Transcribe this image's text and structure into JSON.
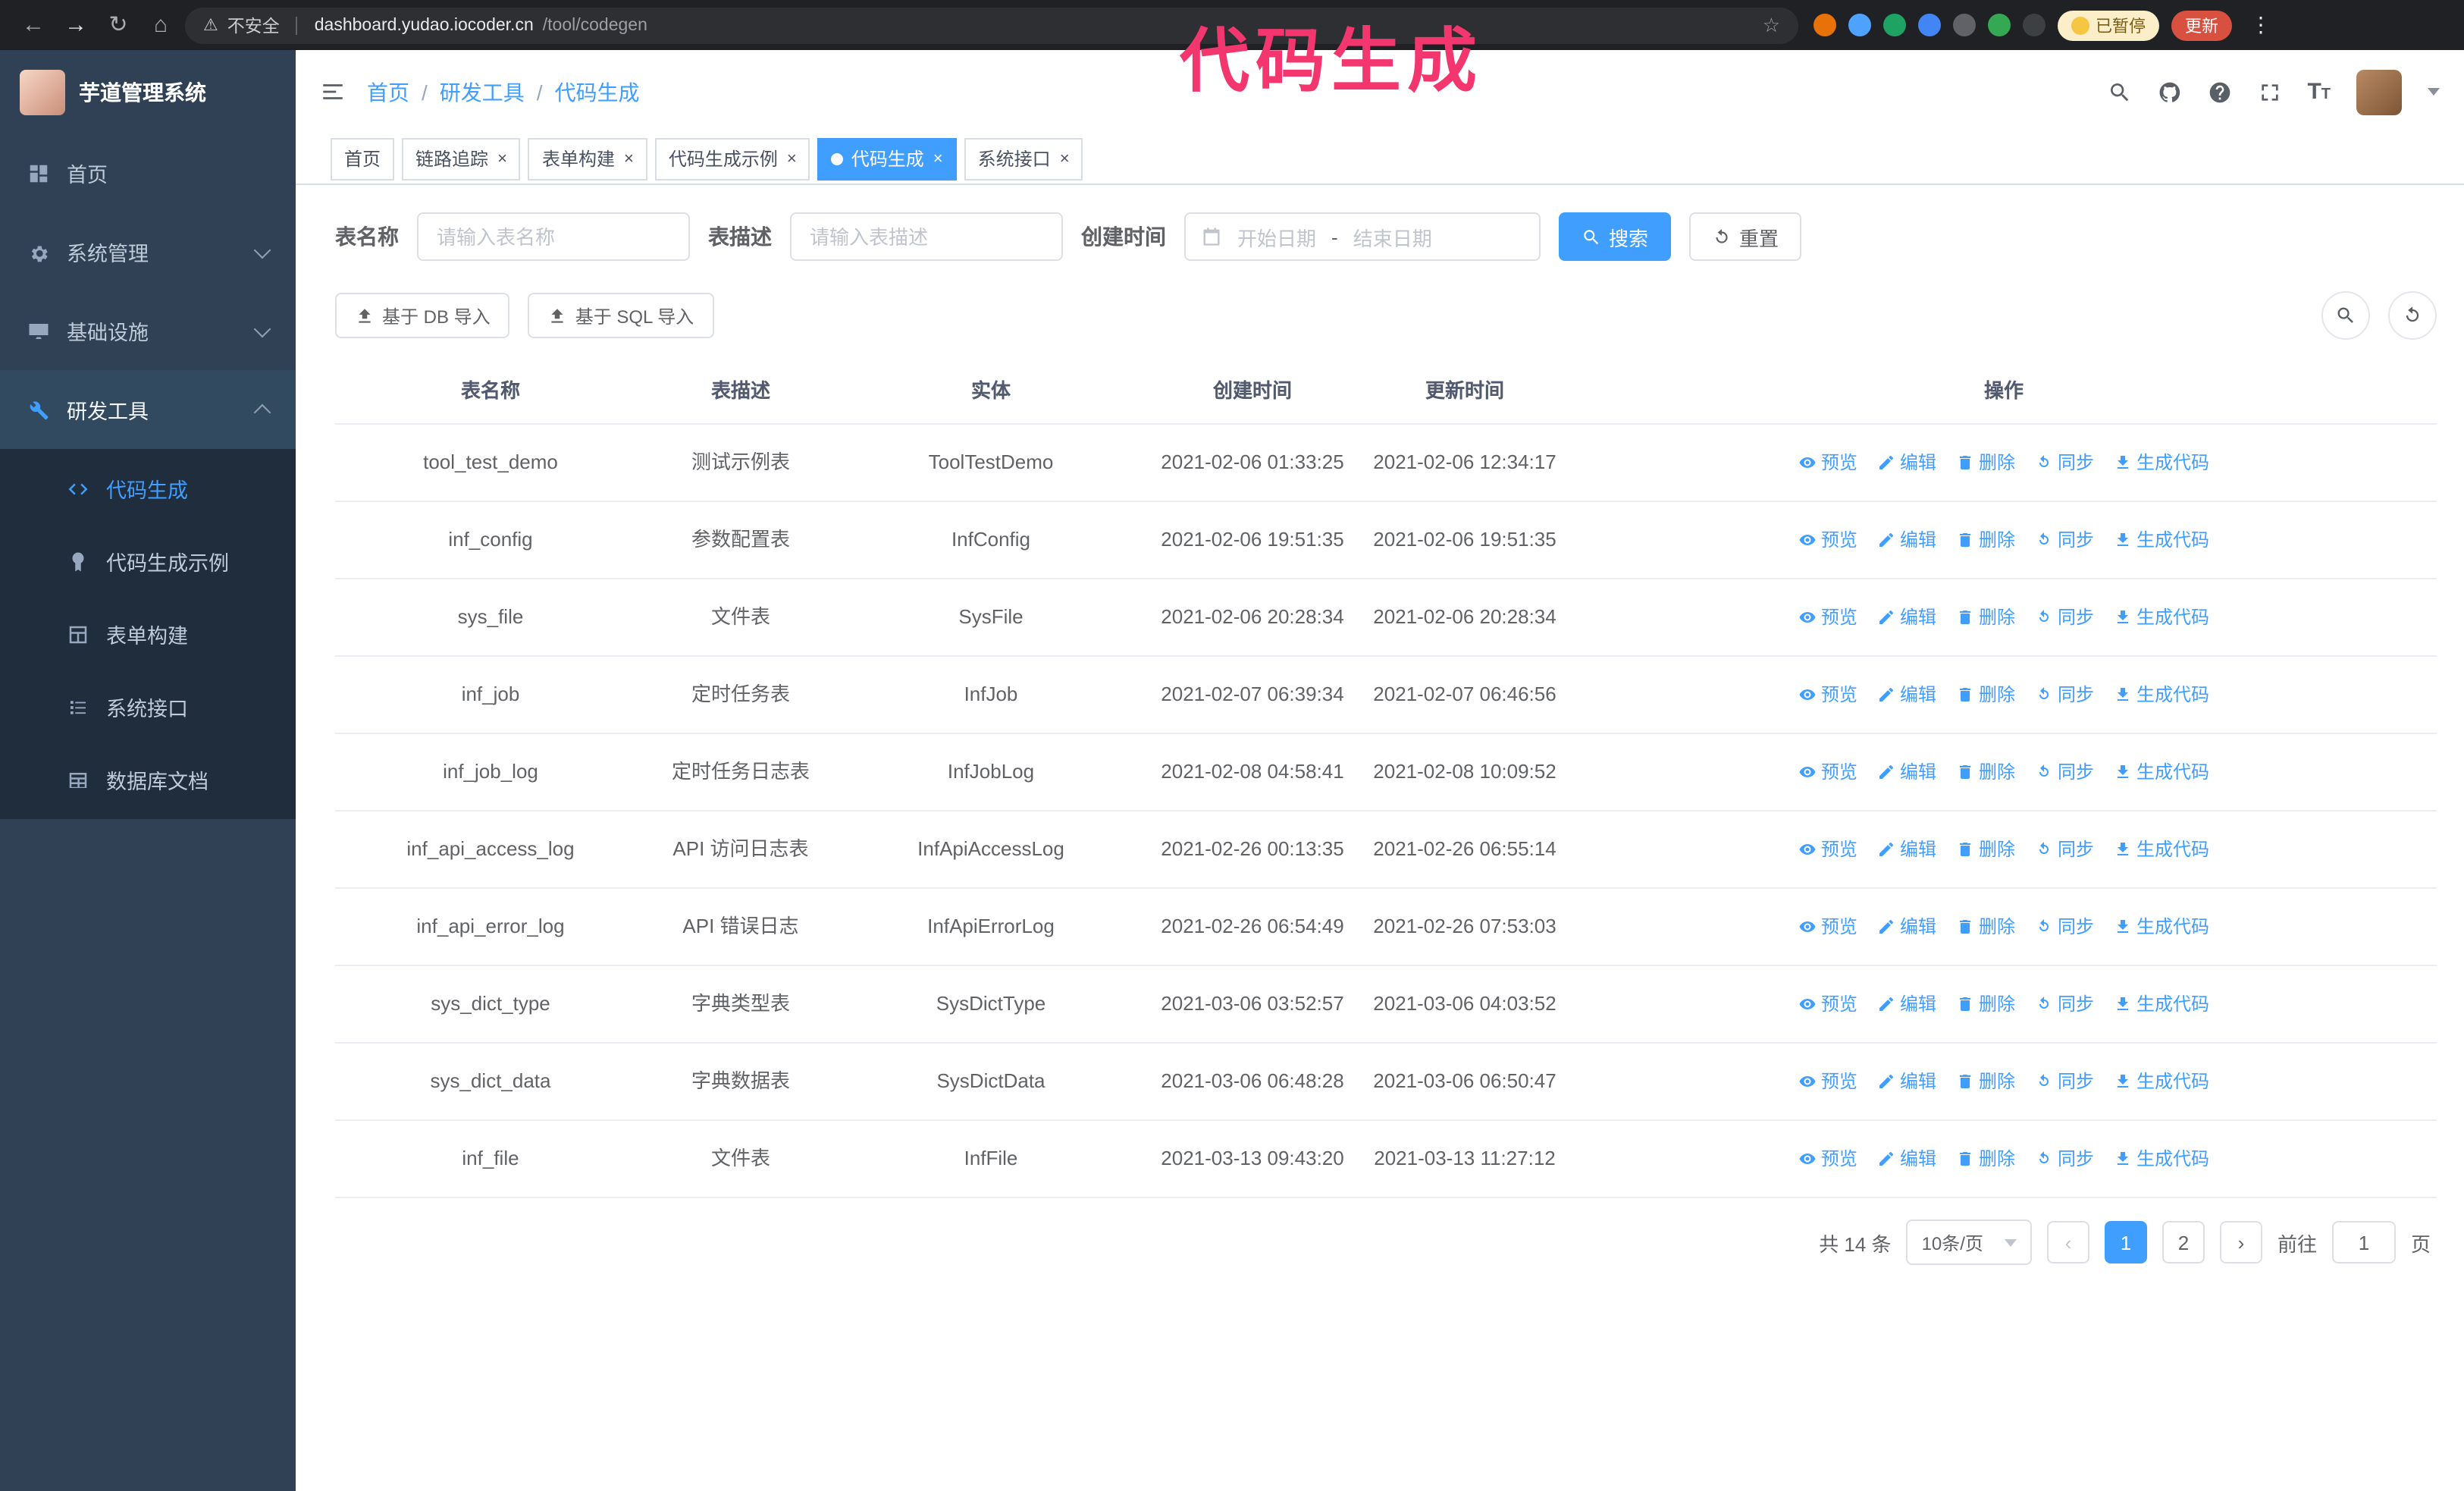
{
  "browser": {
    "security_label": "不安全",
    "url_host": "dashboard.yudao.iocoder.cn",
    "url_path": "/tool/codegen",
    "paused_badge": "已暂停",
    "update_button": "更新"
  },
  "overlay": {
    "text": "代码生成",
    "color": "#f3366e"
  },
  "sidebar": {
    "app_title": "芋道管理系统",
    "items": [
      {
        "id": "home",
        "label": "首页",
        "icon": "dashboard-icon",
        "chevron": null,
        "active": false
      },
      {
        "id": "system",
        "label": "系统管理",
        "icon": "gear-icon",
        "chevron": "down",
        "active": false
      },
      {
        "id": "infra",
        "label": "基础设施",
        "icon": "monitor-icon",
        "chevron": "down",
        "active": false
      },
      {
        "id": "devtools",
        "label": "研发工具",
        "icon": "wrench-icon",
        "chevron": "up",
        "active": true
      }
    ],
    "submenu": [
      {
        "id": "codegen",
        "label": "代码生成",
        "icon": "code-icon",
        "active": true
      },
      {
        "id": "codegen-example",
        "label": "代码生成示例",
        "icon": "badge-icon",
        "active": false
      },
      {
        "id": "form-builder",
        "label": "表单构建",
        "icon": "form-icon",
        "active": false
      },
      {
        "id": "system-api",
        "label": "系统接口",
        "icon": "api-icon",
        "active": false
      },
      {
        "id": "db-doc",
        "label": "数据库文档",
        "icon": "database-icon",
        "active": false
      }
    ]
  },
  "header": {
    "breadcrumb": [
      "首页",
      "研发工具",
      "代码生成"
    ],
    "separator": "/",
    "icons": [
      "search-icon",
      "github-icon",
      "help-icon",
      "fullscreen-icon",
      "font-size-icon"
    ]
  },
  "tabs": [
    {
      "id": "home",
      "label": "首页",
      "closable": false,
      "active": false
    },
    {
      "id": "tracer",
      "label": "链路追踪",
      "closable": true,
      "active": false
    },
    {
      "id": "form-builder",
      "label": "表单构建",
      "closable": true,
      "active": false
    },
    {
      "id": "codegen-example",
      "label": "代码生成示例",
      "closable": true,
      "active": false
    },
    {
      "id": "codegen",
      "label": "代码生成",
      "closable": true,
      "active": true
    },
    {
      "id": "system-api",
      "label": "系统接口",
      "closable": true,
      "active": false
    }
  ],
  "filters": {
    "table_name_label": "表名称",
    "table_name_placeholder": "请输入表名称",
    "table_desc_label": "表描述",
    "table_desc_placeholder": "请输入表描述",
    "create_time_label": "创建时间",
    "date_start_placeholder": "开始日期",
    "date_separator": "-",
    "date_end_placeholder": "结束日期",
    "search_button": "搜索",
    "reset_button": "重置"
  },
  "toolbar": {
    "import_db": "基于 DB 导入",
    "import_sql": "基于 SQL 导入"
  },
  "table": {
    "columns": [
      "表名称",
      "表描述",
      "实体",
      "创建时间",
      "更新时间",
      "操作"
    ],
    "actions": [
      "预览",
      "编辑",
      "删除",
      "同步",
      "生成代码"
    ],
    "action_ids": [
      "preview",
      "edit",
      "delete",
      "sync",
      "generate-code"
    ],
    "action_icons": [
      "eye-icon",
      "edit-icon",
      "trash-icon",
      "sync-icon",
      "download-icon"
    ],
    "rows": [
      {
        "name": "tool_test_demo",
        "desc": "测试示例表",
        "entity": "ToolTestDemo",
        "created": "2021-02-06 01:33:25",
        "updated": "2021-02-06 12:34:17"
      },
      {
        "name": "inf_config",
        "desc": "参数配置表",
        "entity": "InfConfig",
        "created": "2021-02-06 19:51:35",
        "updated": "2021-02-06 19:51:35"
      },
      {
        "name": "sys_file",
        "desc": "文件表",
        "entity": "SysFile",
        "created": "2021-02-06 20:28:34",
        "updated": "2021-02-06 20:28:34"
      },
      {
        "name": "inf_job",
        "desc": "定时任务表",
        "entity": "InfJob",
        "created": "2021-02-07 06:39:34",
        "updated": "2021-02-07 06:46:56"
      },
      {
        "name": "inf_job_log",
        "desc": "定时任务日志表",
        "entity": "InfJobLog",
        "created": "2021-02-08 04:58:41",
        "updated": "2021-02-08 10:09:52"
      },
      {
        "name": "inf_api_access_log",
        "desc": "API 访问日志表",
        "entity": "InfApiAccessLog",
        "created": "2021-02-26 00:13:35",
        "updated": "2021-02-26 06:55:14"
      },
      {
        "name": "inf_api_error_log",
        "desc": "API 错误日志",
        "entity": "InfApiErrorLog",
        "created": "2021-02-26 06:54:49",
        "updated": "2021-02-26 07:53:03"
      },
      {
        "name": "sys_dict_type",
        "desc": "字典类型表",
        "entity": "SysDictType",
        "created": "2021-03-06 03:52:57",
        "updated": "2021-03-06 04:03:52"
      },
      {
        "name": "sys_dict_data",
        "desc": "字典数据表",
        "entity": "SysDictData",
        "created": "2021-03-06 06:48:28",
        "updated": "2021-03-06 06:50:47"
      },
      {
        "name": "inf_file",
        "desc": "文件表",
        "entity": "InfFile",
        "created": "2021-03-13 09:43:20",
        "updated": "2021-03-13 11:27:12"
      }
    ]
  },
  "pagination": {
    "total": "共 14 条",
    "page_size": "10条/页",
    "pages": [
      "1",
      "2"
    ],
    "active_page": "1",
    "goto_label": "前往",
    "goto_value": "1",
    "goto_suffix": "页"
  },
  "colors": {
    "accent": "#409eff",
    "sidebar": "#304156",
    "sidebar_submenu": "#1f2d3d",
    "overlay": "#f3366e",
    "update_button": "#d85140",
    "paused_badge_bg": "#fbeec8"
  }
}
